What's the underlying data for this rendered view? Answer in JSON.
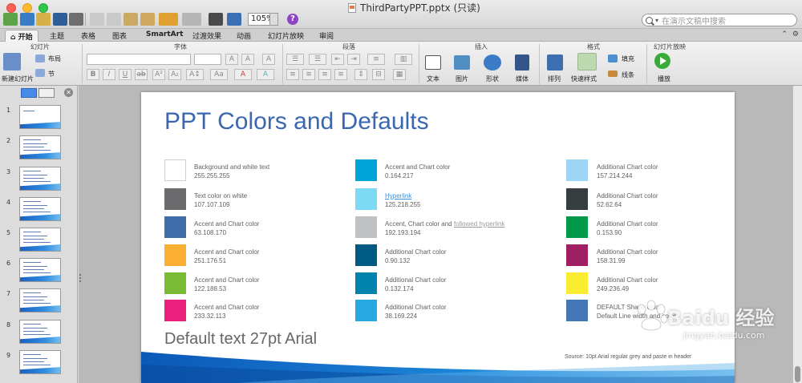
{
  "window": {
    "title": "ThirdPartyPPT.pptx (只读)"
  },
  "toolbar": {
    "zoom": "105%",
    "search_placeholder": "在演示文稿中搜索"
  },
  "ribbon_tabs": [
    "开始",
    "主题",
    "表格",
    "图表",
    "SmartArt",
    "过渡效果",
    "动画",
    "幻灯片放映",
    "审阅"
  ],
  "ribbon_groups": {
    "slides": {
      "label": "幻灯片",
      "new_slide": "新建幻灯片",
      "layout": "布局",
      "section": "节"
    },
    "font": {
      "label": "字体"
    },
    "paragraph": {
      "label": "段落"
    },
    "insert": {
      "label": "插入",
      "text": "文本",
      "picture": "图片",
      "shape": "形状",
      "media": "媒体"
    },
    "format": {
      "label": "格式",
      "arrange": "排列",
      "quick_styles": "快速样式",
      "fill": "填充",
      "line": "线条"
    },
    "slideshow": {
      "label": "幻灯片放映",
      "play": "播放"
    }
  },
  "thumbnails": [
    "1",
    "2",
    "3",
    "4",
    "5",
    "6",
    "7",
    "8",
    "9"
  ],
  "slide": {
    "title": "PPT Colors and Defaults",
    "default_text": "Default text 27pt Arial",
    "source": "Source: 10pt Arial regular grey and paste in header",
    "swatches": [
      {
        "color": "#ffffff",
        "label": "Background and white text",
        "rgb": "255.255.255"
      },
      {
        "color": "#6b6b6d",
        "label": "Text color on white",
        "rgb": "107.107.109"
      },
      {
        "color": "#3f6caa",
        "label": "Accent and Chart color",
        "rgb": "63.108.170"
      },
      {
        "color": "#fbb033",
        "label": "Accent and Chart color",
        "rgb": "251.176.51"
      },
      {
        "color": "#7abb35",
        "label": "Accent and Chart color",
        "rgb": "122.188.53"
      },
      {
        "color": "#e9207d",
        "label": "Accent and Chart color",
        "rgb": "233.32.113"
      },
      {
        "color": "#00a4d9",
        "label": "Accent and Chart color",
        "rgb": "0.164.217"
      },
      {
        "color": "#7ddaf5",
        "label": "Hyperlink",
        "rgb": "125.218.255"
      },
      {
        "color": "#c0c1c2",
        "label_prefix": "Accent, Chart color and ",
        "label_link": "followed hyperlink",
        "rgb": "192.193.194"
      },
      {
        "color": "#005a84",
        "label": "Additional Chart color",
        "rgb": "0.90.132"
      },
      {
        "color": "#0084ae",
        "label": "Additional Chart color",
        "rgb": "0.132.174"
      },
      {
        "color": "#26a9e0",
        "label": "Additional Chart color",
        "rgb": "38.169.224"
      },
      {
        "color": "#9dd6f4",
        "label": "Additional Chart color",
        "rgb": "157.214.244"
      },
      {
        "color": "#343e40",
        "label": "Additional Chart color",
        "rgb": "52.62.64"
      },
      {
        "color": "#009948",
        "label": "Additional Chart color",
        "rgb": "0.153.90"
      },
      {
        "color": "#9e1f63",
        "label": "Additional Chart color",
        "rgb": "158.31.99"
      },
      {
        "color": "#f9ec31",
        "label": "Additional Chart color",
        "rgb": "249.236.49"
      },
      {
        "color": "#4377b6",
        "label": "DEFAULT Shape color",
        "rgb": "Default Line width and color"
      }
    ]
  },
  "watermark": {
    "text": "Baidu 经验",
    "sub": "jingyan.baidu.com"
  }
}
